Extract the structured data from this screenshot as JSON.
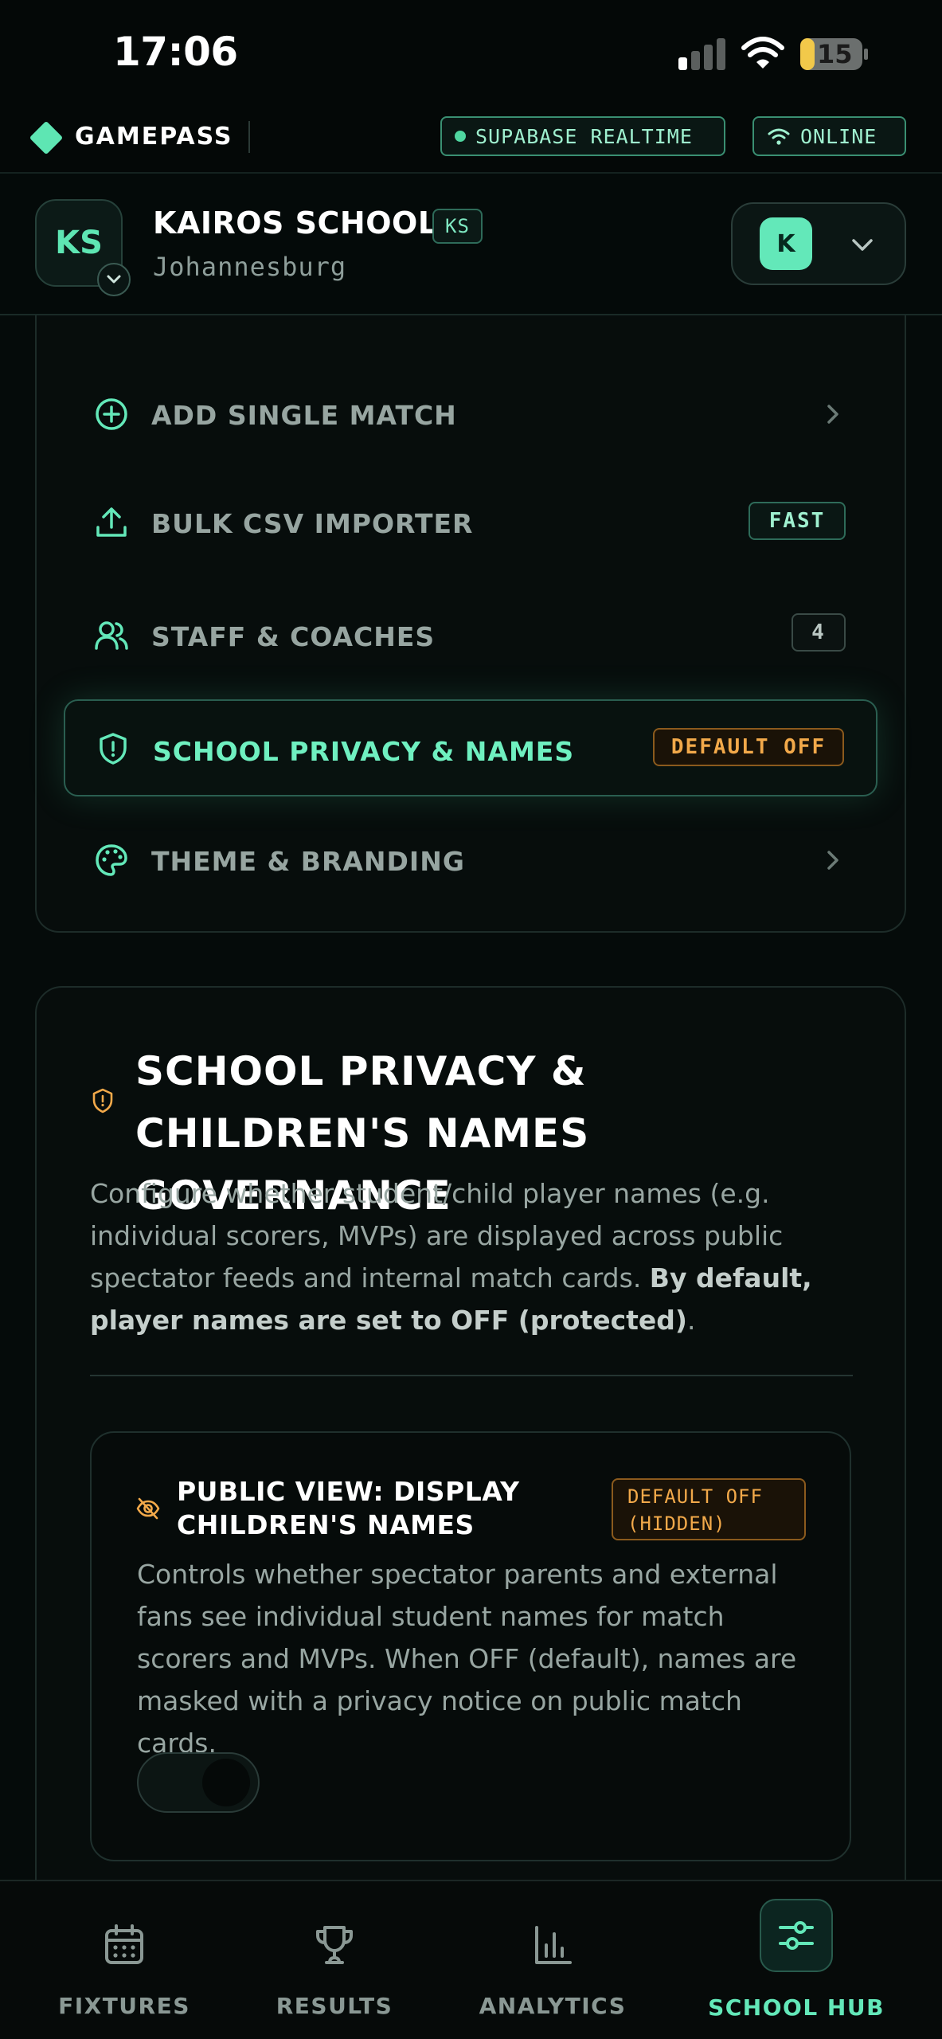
{
  "status_bar": {
    "time": "17:06",
    "battery": "15"
  },
  "app_bar": {
    "brand": "GAMEPASS",
    "realtime_chip": "SUPABASE REALTIME",
    "online_chip": "ONLINE"
  },
  "school": {
    "initials": "KS",
    "name": "KAIROS SCHOOL",
    "code": "KS",
    "city": "Johannesburg",
    "user_initial": "K"
  },
  "menu": {
    "items": [
      {
        "label": "ADD SINGLE MATCH",
        "icon": "plus-circle-icon"
      },
      {
        "label": "BULK CSV IMPORTER",
        "icon": "upload-icon",
        "badge": "FAST"
      },
      {
        "label": "STAFF & COACHES",
        "icon": "users-icon",
        "badge": "4"
      },
      {
        "label": "SCHOOL PRIVACY & NAMES",
        "icon": "shield-icon",
        "badge": "DEFAULT OFF"
      },
      {
        "label": "THEME & BRANDING",
        "icon": "palette-icon"
      }
    ]
  },
  "privacy": {
    "title": "SCHOOL PRIVACY & CHILDREN'S NAMES GOVERNANCE",
    "description": "Configure whether student/child player names (e.g. individual scorers, MVPs) are displayed across public spectator feeds and internal match cards. ",
    "description_bold": "By default, player names are set to OFF (protected)",
    "description_end": ".",
    "setting": {
      "title": "PUBLIC VIEW: DISPLAY CHILDREN'S NAMES",
      "badge_line1": "DEFAULT OFF",
      "badge_line2": "(HIDDEN)",
      "description": "Controls whether spectator parents and external fans see individual student names for match scorers and MVPs. When OFF (default), names are masked with a privacy notice on public match cards.",
      "toggle_state": "off"
    }
  },
  "bottom_nav": {
    "items": [
      {
        "label": "FIXTURES",
        "icon": "calendar-icon"
      },
      {
        "label": "RESULTS",
        "icon": "trophy-icon"
      },
      {
        "label": "ANALYTICS",
        "icon": "bar-chart-icon"
      },
      {
        "label": "SCHOOL HUB",
        "icon": "sliders-icon",
        "active": true
      }
    ]
  },
  "colors": {
    "accent": "#63e8b9",
    "warning": "#f2a94a",
    "background": "#050b0a"
  }
}
